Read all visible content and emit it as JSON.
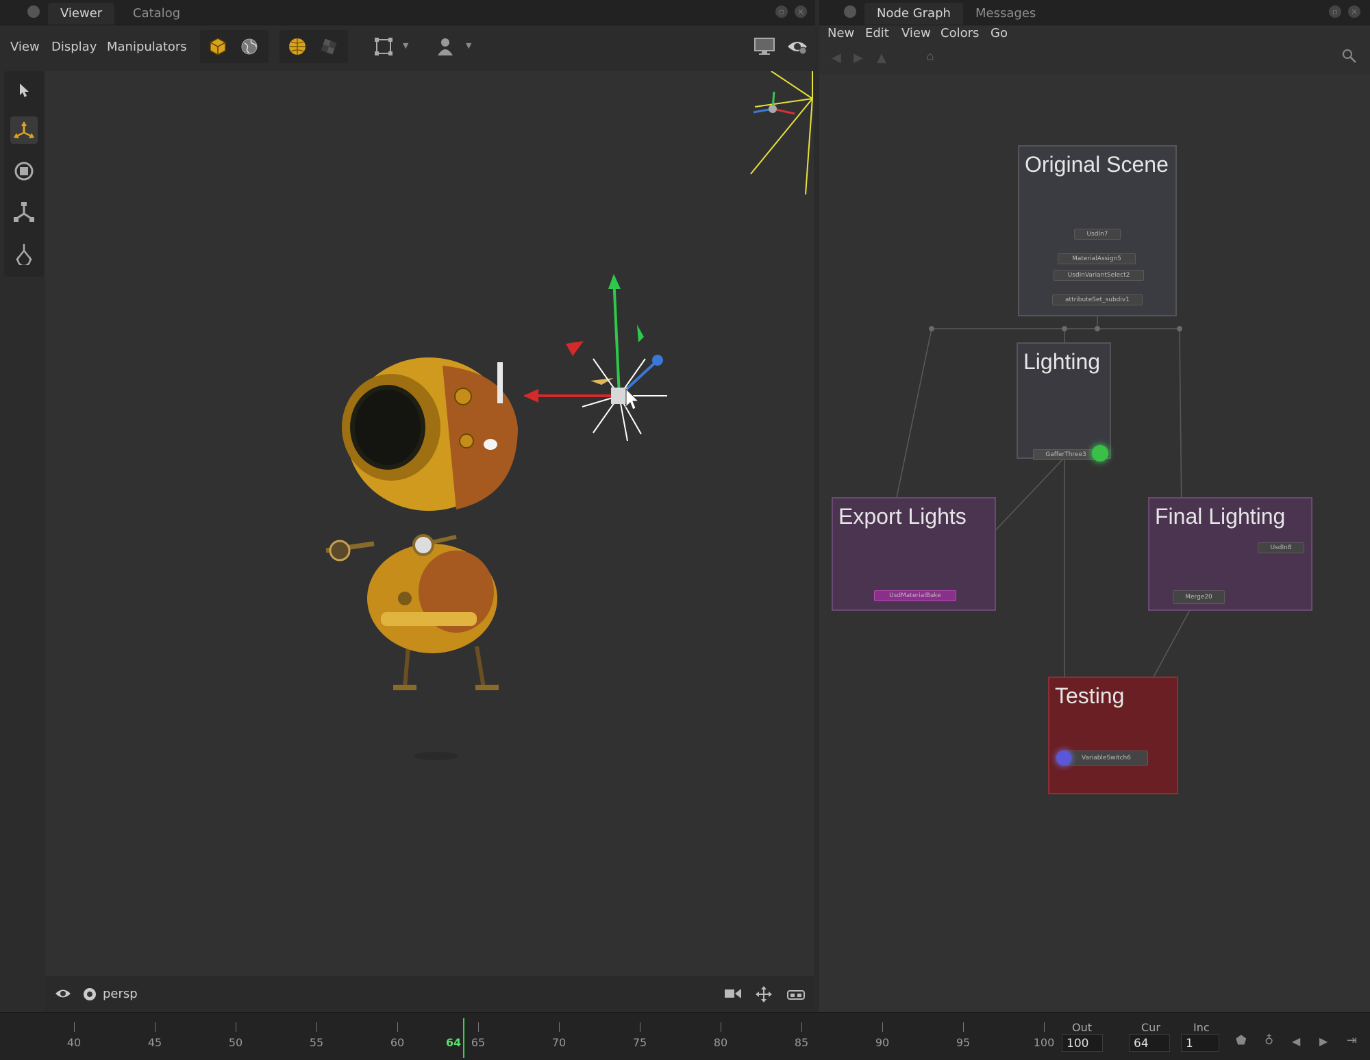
{
  "viewer": {
    "tabs": [
      "Viewer",
      "Catalog"
    ],
    "menu": [
      "View",
      "Display",
      "Manipulators"
    ],
    "camera_label": "persp"
  },
  "node_graph": {
    "tabs": [
      "Node Graph",
      "Messages"
    ],
    "menu": [
      "New",
      "Edit",
      "View",
      "Colors",
      "Go"
    ],
    "backdrops": {
      "original_scene": {
        "title": "Original Scene",
        "nodes": [
          "UsdIn7",
          "MaterialAssign5",
          "UsdInVariantSelect2",
          "attributeSet_subdiv1"
        ]
      },
      "lighting": {
        "title": "Lighting",
        "nodes": [
          "GafferThree3"
        ]
      },
      "export_lights": {
        "title": "Export Lights",
        "nodes": [
          "UsdMaterialBake"
        ]
      },
      "final_lighting": {
        "title": "Final Lighting",
        "nodes": [
          "UsdIn8",
          "Merge20"
        ]
      },
      "testing": {
        "title": "Testing",
        "nodes": [
          "VariableSwitch6"
        ]
      }
    },
    "colors": {
      "original_scene": "#3b3b42",
      "lighting": "#3a3a40",
      "export_lights": "#4a3450",
      "final_lighting": "#4a3450",
      "testing": "#6a1f24"
    }
  },
  "timeline": {
    "ticks": [
      "40",
      "45",
      "50",
      "55",
      "60",
      "65",
      "70",
      "75",
      "80",
      "85",
      "90",
      "95",
      "100"
    ],
    "current_frame_marker": "64",
    "out_label": "Out",
    "out_value": "100",
    "cur_label": "Cur",
    "cur_value": "64",
    "inc_label": "Inc",
    "inc_value": "1"
  },
  "icons": [
    "select-arrow-icon",
    "translate-icon",
    "rotate-icon",
    "scale-icon",
    "light-manipulator-icon",
    "cube-icon",
    "globe-icon",
    "shaded-sphere-icon",
    "checker-icon",
    "frame-icon",
    "person-icon",
    "monitor-icon",
    "eye-icon"
  ]
}
